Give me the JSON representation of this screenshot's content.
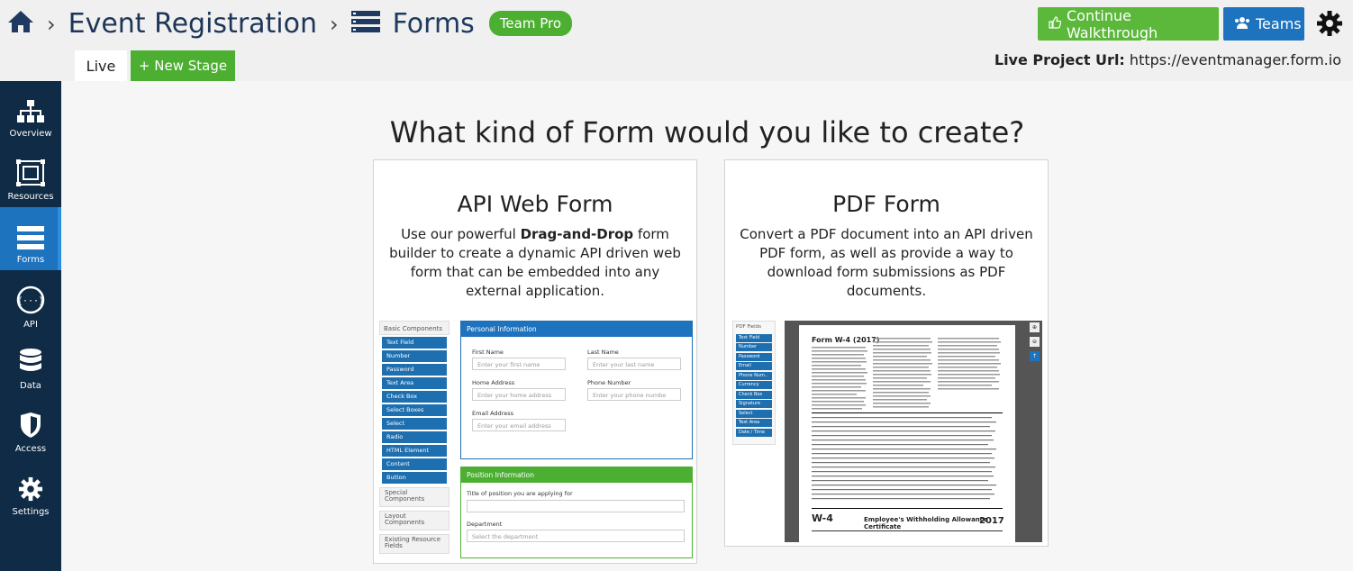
{
  "header": {
    "breadcrumb": [
      "Event Registration",
      "Forms"
    ],
    "badge": "Team Pro",
    "walkthrough_label": "Continue Walkthrough",
    "teams_label": "Teams",
    "colors": {
      "green": "#5cb83a",
      "blue": "#1e73be",
      "navy": "#0f2b45"
    }
  },
  "stages": {
    "live": "Live",
    "new_stage": "+ New Stage"
  },
  "live_url": {
    "label": "Live Project Url:",
    "value": "https://eventmanager.form.io"
  },
  "sidebar": {
    "items": [
      {
        "label": "Overview",
        "icon": "sitemap-icon"
      },
      {
        "label": "Resources",
        "icon": "resources-icon"
      },
      {
        "label": "Forms",
        "icon": "forms-icon",
        "active": true
      },
      {
        "label": "API",
        "icon": "api-icon"
      },
      {
        "label": "Data",
        "icon": "database-icon"
      },
      {
        "label": "Access",
        "icon": "shield-icon"
      },
      {
        "label": "Settings",
        "icon": "gear-icon"
      }
    ]
  },
  "main": {
    "question": "What kind of Form would you like to create?",
    "api_card": {
      "title": "API Web Form",
      "desc_pre": "Use our powerful ",
      "desc_bold": "Drag-and-Drop",
      "desc_post": " form builder to create a dynamic API driven web form that can be embedded into any external application.",
      "preview": {
        "basic_components": "Basic Components",
        "components": [
          "Text Field",
          "Number",
          "Password",
          "Text Area",
          "Check Box",
          "Select Boxes",
          "Select",
          "Radio",
          "HTML Element",
          "Content",
          "Button"
        ],
        "groups": [
          "Special Components",
          "Layout Components",
          "Existing Resource Fields"
        ],
        "personal_info": "Personal Information",
        "first_name": "First Name",
        "first_name_ph": "Enter your first name",
        "last_name": "Last Name",
        "last_name_ph": "Enter your last name",
        "home_address": "Home Address",
        "home_address_ph": "Enter your home address",
        "phone": "Phone Number",
        "phone_ph": "Enter your phone numbe",
        "email": "Email Address",
        "email_ph": "Enter your email address",
        "position_info": "Position Information",
        "position_title": "Title of position you are applying for",
        "department": "Department",
        "department_ph": "Select the department"
      }
    },
    "pdf_card": {
      "title": "PDF Form",
      "desc": "Convert a PDF document into an API driven PDF form, as well as provide a way to download form submissions as PDF documents.",
      "preview": {
        "fields_head": "PDF Fields",
        "fields": [
          "Text Field",
          "Number",
          "Password",
          "Email",
          "Phone Num..",
          "Currency",
          "Check Box",
          "Signature",
          "Select",
          "Text Area",
          "Date / Time"
        ],
        "w4_title": "Form W-4 (2017)",
        "w4_bottom": "W-4",
        "w4_cert": "Employee's Withholding Allowance Certificate",
        "w4_year": "2017"
      }
    }
  }
}
